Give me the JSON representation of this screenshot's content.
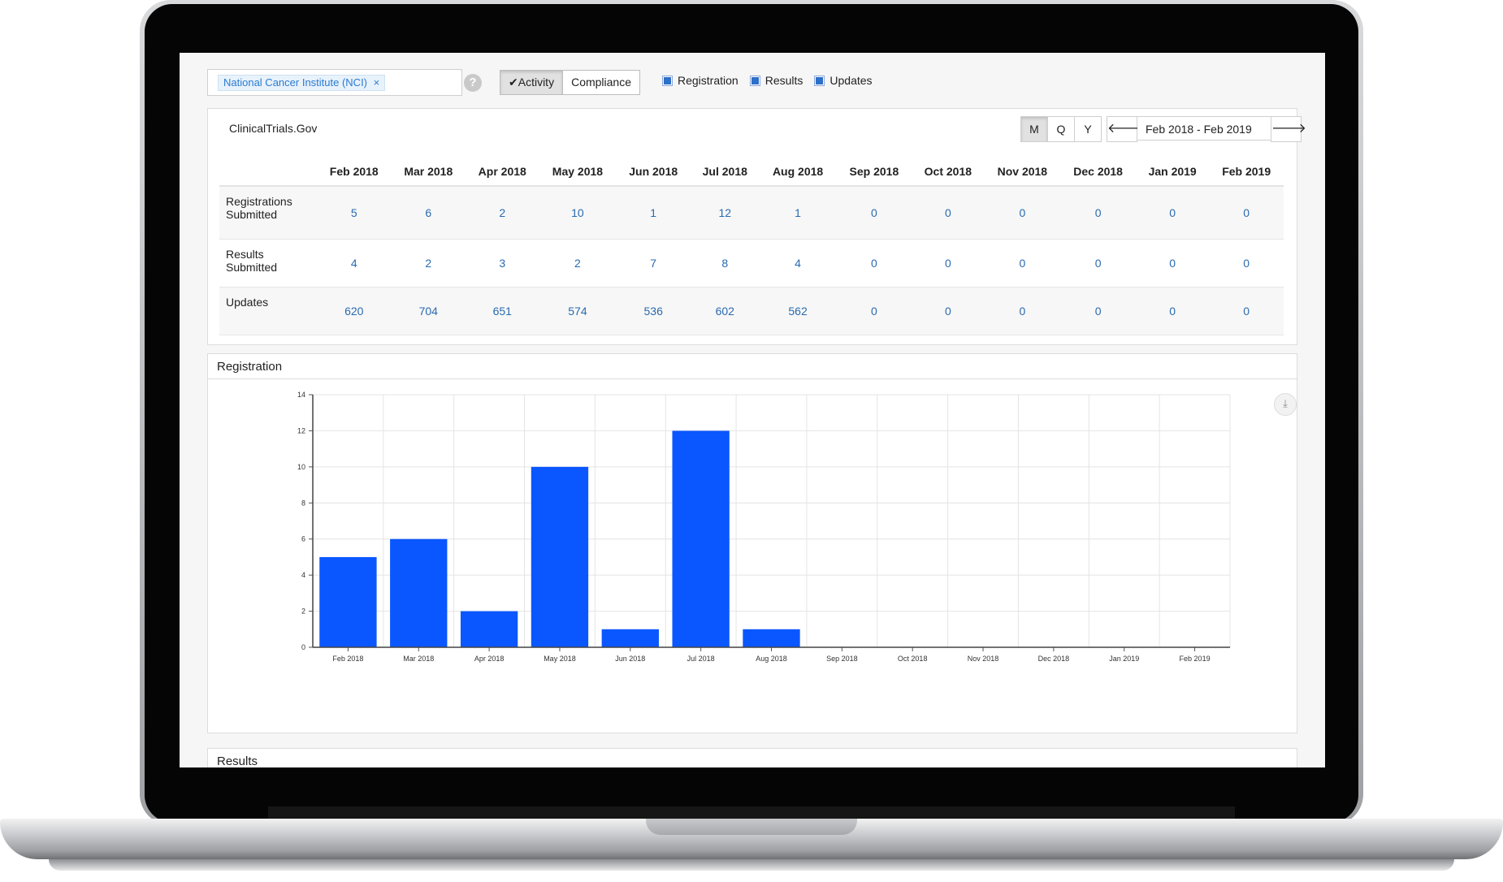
{
  "filter": {
    "org_tag": "National Cancer Institute (NCI)",
    "tag_close": "×",
    "help_icon": "?"
  },
  "view_toggle": {
    "activity": "✔Activity",
    "compliance": "Compliance"
  },
  "checkboxes": [
    "Registration",
    "Results",
    "Updates"
  ],
  "summary": {
    "source_title": "ClinicalTrials.Gov",
    "period_buttons": [
      "M",
      "Q",
      "Y"
    ],
    "prev_icon": "🡐",
    "next_icon": "🡒",
    "range_label": "Feb 2018 - Feb 2019",
    "columns": [
      "Feb 2018",
      "Mar 2018",
      "Apr 2018",
      "May 2018",
      "Jun 2018",
      "Jul 2018",
      "Aug 2018",
      "Sep 2018",
      "Oct 2018",
      "Nov 2018",
      "Dec 2018",
      "Jan 2019",
      "Feb 2019"
    ],
    "rows": [
      {
        "label": "Registrations Submitted",
        "values": [
          "5",
          "6",
          "2",
          "10",
          "1",
          "12",
          "1",
          "0",
          "0",
          "0",
          "0",
          "0",
          "0"
        ]
      },
      {
        "label": "Results Submitted",
        "values": [
          "4",
          "2",
          "3",
          "2",
          "7",
          "8",
          "4",
          "0",
          "0",
          "0",
          "0",
          "0",
          "0"
        ]
      },
      {
        "label": "Updates",
        "values": [
          "620",
          "704",
          "651",
          "574",
          "536",
          "602",
          "562",
          "0",
          "0",
          "0",
          "0",
          "0",
          "0"
        ]
      }
    ]
  },
  "registration_panel": {
    "title": "Registration",
    "download_icon": "⤓"
  },
  "chart_data": {
    "type": "bar",
    "categories": [
      "Feb 2018",
      "Mar 2018",
      "Apr 2018",
      "May 2018",
      "Jun 2018",
      "Jul 2018",
      "Aug 2018",
      "Sep 2018",
      "Oct 2018",
      "Nov 2018",
      "Dec 2018",
      "Jan 2019",
      "Feb 2019"
    ],
    "values": [
      5,
      6,
      2,
      10,
      1,
      12,
      1,
      0,
      0,
      0,
      0,
      0,
      0
    ],
    "ylim": [
      0,
      14
    ],
    "yticks": [
      0,
      2,
      4,
      6,
      8,
      10,
      12,
      14
    ],
    "grid": true,
    "bar_color": "#0a57ff"
  },
  "results_panel": {
    "title": "Results"
  }
}
